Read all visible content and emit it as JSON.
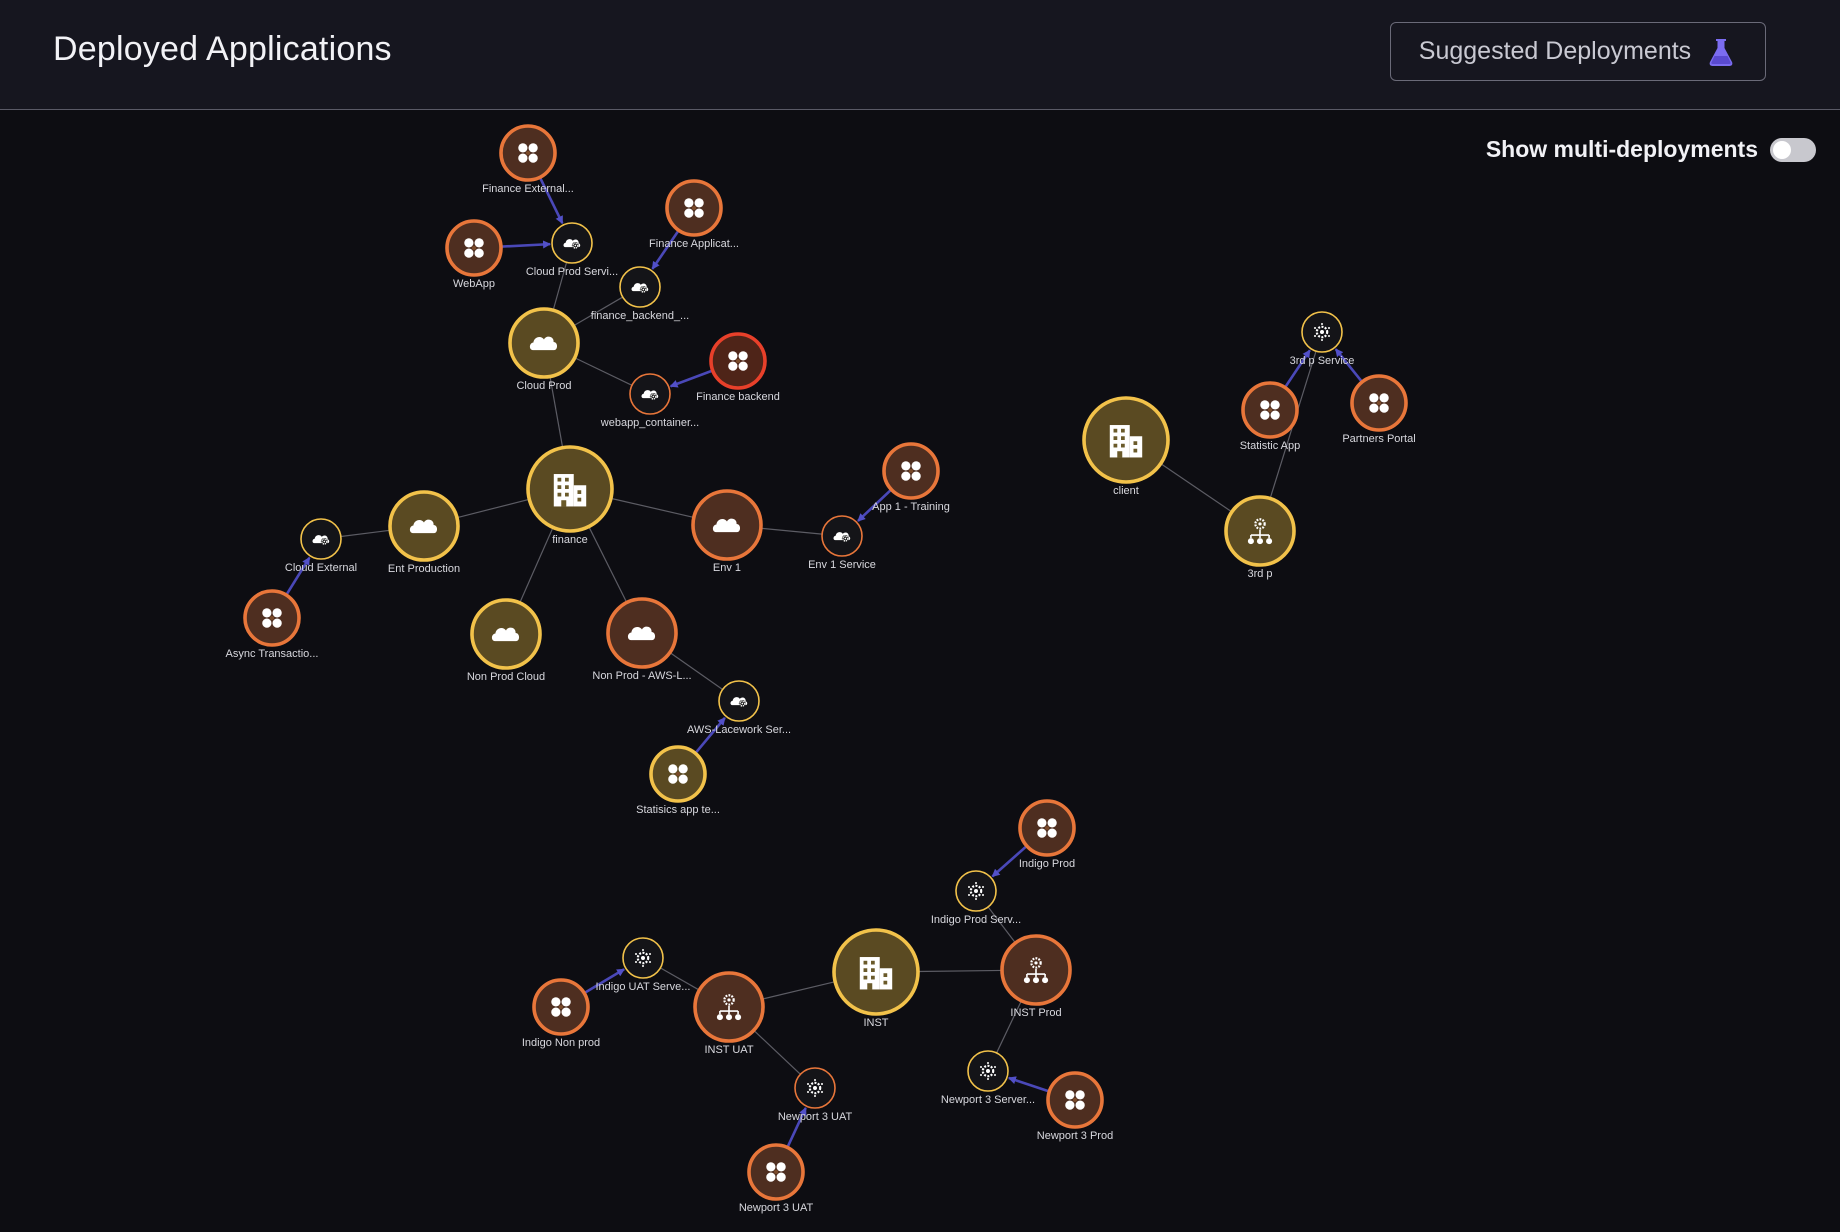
{
  "header": {
    "title": "Deployed Applications",
    "suggested_button_label": "Suggested Deployments",
    "suggested_button_icon": "flask-icon"
  },
  "toggle": {
    "label": "Show multi-deployments",
    "state": "off"
  },
  "colors": {
    "orange_ring": "#e8763a",
    "yellow_ring": "#f2c24a",
    "red_ring": "#e8402a",
    "edge": "#6a6a72",
    "arrow": "#4a48b8",
    "accent_flask": "#7b6cf0"
  },
  "nodes": [
    {
      "id": "finance",
      "label": "finance",
      "kind": "building",
      "ring": "yellow"
    },
    {
      "id": "cloud_prod",
      "label": "Cloud Prod",
      "kind": "cloud",
      "ring": "yellow"
    },
    {
      "id": "cloud_prod_svc",
      "label": "Cloud Prod Servi...",
      "kind": "service",
      "ring": "yellow"
    },
    {
      "id": "fin_ext",
      "label": "Finance External...",
      "kind": "app",
      "ring": "orange"
    },
    {
      "id": "webapp",
      "label": "WebApp",
      "kind": "app",
      "ring": "orange"
    },
    {
      "id": "fin_app",
      "label": "Finance Applicat...",
      "kind": "app",
      "ring": "orange"
    },
    {
      "id": "fin_backend_svc",
      "label": "finance_backend_...",
      "kind": "service",
      "ring": "yellow"
    },
    {
      "id": "webapp_container",
      "label": "webapp_container...",
      "kind": "service",
      "ring": "orange"
    },
    {
      "id": "fin_backend",
      "label": "Finance backend",
      "kind": "app",
      "ring": "red"
    },
    {
      "id": "ent_prod",
      "label": "Ent Production",
      "kind": "cloud",
      "ring": "yellow"
    },
    {
      "id": "cloud_ext",
      "label": "Cloud External",
      "kind": "service",
      "ring": "yellow"
    },
    {
      "id": "async_tx",
      "label": "Async Transactio...",
      "kind": "app",
      "ring": "orange"
    },
    {
      "id": "env1",
      "label": "Env 1",
      "kind": "cloud",
      "ring": "orange"
    },
    {
      "id": "env1_svc",
      "label": "Env 1 Service",
      "kind": "service",
      "ring": "orange"
    },
    {
      "id": "app1_training",
      "label": "App 1 - Training",
      "kind": "app",
      "ring": "orange"
    },
    {
      "id": "nonprod_cloud",
      "label": "Non Prod Cloud",
      "kind": "cloud",
      "ring": "yellow"
    },
    {
      "id": "nonprod_aws",
      "label": "Non Prod - AWS-L...",
      "kind": "cloud",
      "ring": "orange"
    },
    {
      "id": "aws_lacework",
      "label": "AWS-Lacework Ser...",
      "kind": "service",
      "ring": "yellow"
    },
    {
      "id": "statisics_app",
      "label": "Statisics app te...",
      "kind": "app",
      "ring": "yellow"
    },
    {
      "id": "client",
      "label": "client",
      "kind": "building",
      "ring": "yellow"
    },
    {
      "id": "third_p",
      "label": "3rd p",
      "kind": "cluster",
      "ring": "yellow"
    },
    {
      "id": "third_p_svc",
      "label": "3rd p Service",
      "kind": "gear",
      "ring": "yellow"
    },
    {
      "id": "statistic_app",
      "label": "Statistic App",
      "kind": "app",
      "ring": "orange"
    },
    {
      "id": "partners_portal",
      "label": "Partners Portal",
      "kind": "app",
      "ring": "orange"
    },
    {
      "id": "inst",
      "label": "INST",
      "kind": "building",
      "ring": "yellow"
    },
    {
      "id": "inst_uat",
      "label": "INST UAT",
      "kind": "cluster",
      "ring": "orange"
    },
    {
      "id": "inst_prod",
      "label": "INST Prod",
      "kind": "cluster",
      "ring": "orange"
    },
    {
      "id": "indigo_prod",
      "label": "Indigo Prod",
      "kind": "app",
      "ring": "orange"
    },
    {
      "id": "indigo_prod_svc",
      "label": "Indigo Prod Serv...",
      "kind": "gear",
      "ring": "yellow"
    },
    {
      "id": "indigo_uat_svc",
      "label": "Indigo UAT Serve...",
      "kind": "gear",
      "ring": "yellow"
    },
    {
      "id": "indigo_nonprod",
      "label": "Indigo Non prod",
      "kind": "app",
      "ring": "orange"
    },
    {
      "id": "newport3_uat_svc",
      "label": "Newport 3 UAT",
      "kind": "gear",
      "ring": "orange"
    },
    {
      "id": "newport3_uat",
      "label": "Newport 3 UAT",
      "kind": "app",
      "ring": "orange"
    },
    {
      "id": "newport3_svc",
      "label": "Newport 3 Server...",
      "kind": "gear",
      "ring": "yellow"
    },
    {
      "id": "newport3_prod",
      "label": "Newport 3 Prod",
      "kind": "app",
      "ring": "orange"
    }
  ],
  "edges": [
    {
      "from": "finance",
      "to": "cloud_prod",
      "arrow": false
    },
    {
      "from": "cloud_prod",
      "to": "cloud_prod_svc",
      "arrow": false
    },
    {
      "from": "cloud_prod",
      "to": "fin_backend_svc",
      "arrow": false
    },
    {
      "from": "cloud_prod",
      "to": "webapp_container",
      "arrow": false
    },
    {
      "from": "fin_ext",
      "to": "cloud_prod_svc",
      "arrow": true
    },
    {
      "from": "webapp",
      "to": "cloud_prod_svc",
      "arrow": true
    },
    {
      "from": "fin_app",
      "to": "fin_backend_svc",
      "arrow": true
    },
    {
      "from": "fin_backend",
      "to": "webapp_container",
      "arrow": true
    },
    {
      "from": "finance",
      "to": "ent_prod",
      "arrow": false
    },
    {
      "from": "ent_prod",
      "to": "cloud_ext",
      "arrow": false
    },
    {
      "from": "async_tx",
      "to": "cloud_ext",
      "arrow": true
    },
    {
      "from": "finance",
      "to": "env1",
      "arrow": false
    },
    {
      "from": "env1",
      "to": "env1_svc",
      "arrow": false
    },
    {
      "from": "app1_training",
      "to": "env1_svc",
      "arrow": true
    },
    {
      "from": "finance",
      "to": "nonprod_cloud",
      "arrow": false
    },
    {
      "from": "finance",
      "to": "nonprod_aws",
      "arrow": false
    },
    {
      "from": "nonprod_aws",
      "to": "aws_lacework",
      "arrow": false
    },
    {
      "from": "statisics_app",
      "to": "aws_lacework",
      "arrow": true
    },
    {
      "from": "client",
      "to": "third_p",
      "arrow": false
    },
    {
      "from": "third_p",
      "to": "third_p_svc",
      "arrow": false
    },
    {
      "from": "statistic_app",
      "to": "third_p_svc",
      "arrow": true
    },
    {
      "from": "partners_portal",
      "to": "third_p_svc",
      "arrow": true
    },
    {
      "from": "inst",
      "to": "inst_uat",
      "arrow": false
    },
    {
      "from": "inst",
      "to": "inst_prod",
      "arrow": false
    },
    {
      "from": "inst_prod",
      "to": "indigo_prod_svc",
      "arrow": false
    },
    {
      "from": "indigo_prod",
      "to": "indigo_prod_svc",
      "arrow": true
    },
    {
      "from": "inst_uat",
      "to": "indigo_uat_svc",
      "arrow": false
    },
    {
      "from": "indigo_nonprod",
      "to": "indigo_uat_svc",
      "arrow": true
    },
    {
      "from": "inst_uat",
      "to": "newport3_uat_svc",
      "arrow": false
    },
    {
      "from": "newport3_uat",
      "to": "newport3_uat_svc",
      "arrow": true
    },
    {
      "from": "inst_prod",
      "to": "newport3_svc",
      "arrow": false
    },
    {
      "from": "newport3_prod",
      "to": "newport3_svc",
      "arrow": true
    }
  ]
}
